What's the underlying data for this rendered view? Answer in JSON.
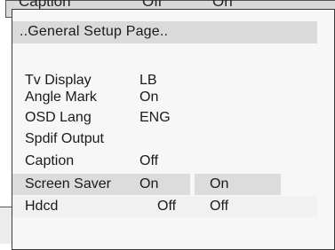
{
  "background_menu": {
    "label": "Caption",
    "value": "Off",
    "sub_value": "On"
  },
  "page": {
    "title": "..General Setup Page.."
  },
  "settings": [
    {
      "label": "Tv Display",
      "value": "LB",
      "sub_value": ""
    },
    {
      "label": "Angle Mark",
      "value": "On",
      "sub_value": ""
    },
    {
      "label": "OSD Lang",
      "value": "ENG",
      "sub_value": ""
    },
    {
      "label": "Spdif Output",
      "value": "",
      "sub_value": ""
    },
    {
      "label": "Caption",
      "value": "Off",
      "sub_value": ""
    },
    {
      "label": "Screen Saver",
      "value": "On",
      "sub_value": "On"
    },
    {
      "label": "Hdcd",
      "value": "Off",
      "sub_value": "Off"
    }
  ],
  "colors": {
    "panel_background": "#f7f7f7",
    "title_bar": "#dadada",
    "highlight": "#dcdcdc",
    "text": "#1a1a1a"
  }
}
